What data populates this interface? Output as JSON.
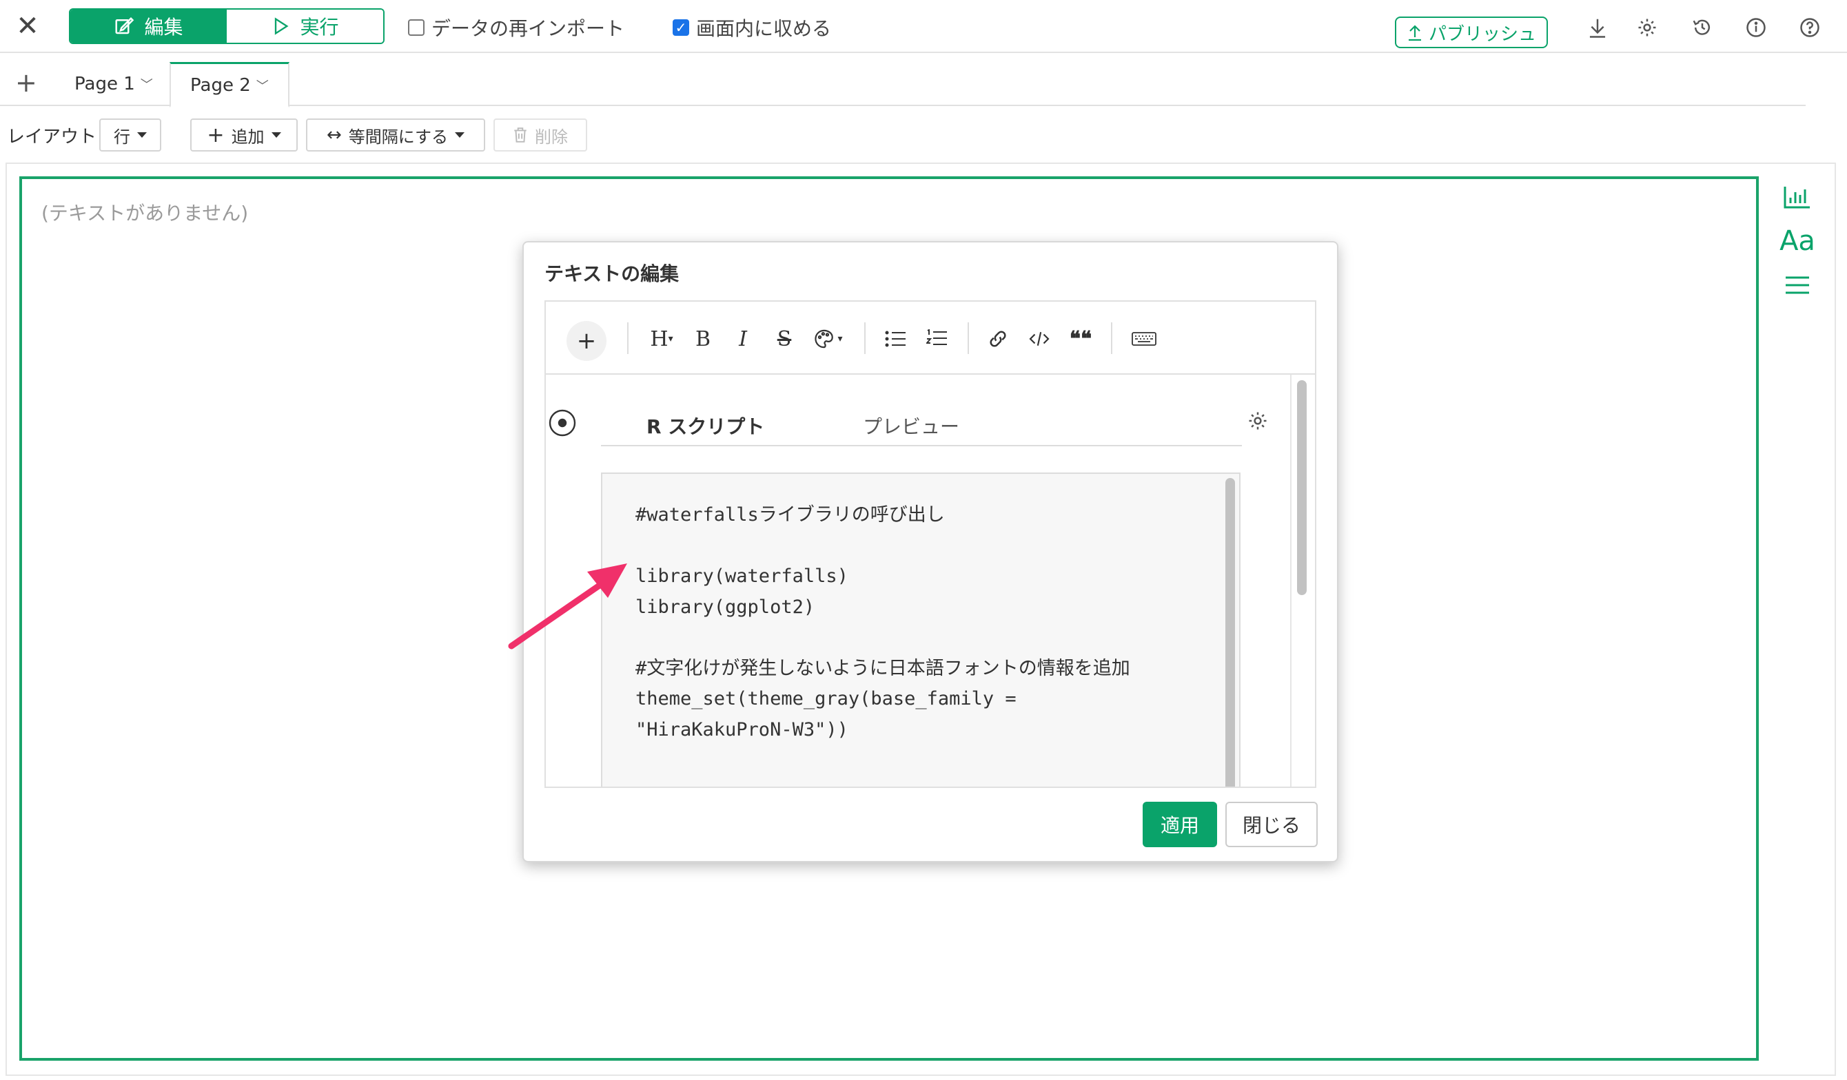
{
  "toolbar": {
    "edit_label": "編集",
    "run_label": "実行",
    "reimport_label": "データの再インポート",
    "reimport_checked": false,
    "fit_label": "画面内に収める",
    "fit_checked": true,
    "publish_label": "パブリッシュ"
  },
  "tabs": {
    "items": [
      {
        "label": "Page 1",
        "active": false
      },
      {
        "label": "Page 2",
        "active": true
      }
    ]
  },
  "layoutbar": {
    "layout_label": "レイアウト",
    "row_label": "行",
    "add_label": "追加",
    "spacing_label": "等間隔にする",
    "delete_label": "削除"
  },
  "canvas": {
    "placeholder": "(テキストがありません)"
  },
  "dialog": {
    "title": "テキストの編集",
    "tab_script": "R スクリプト",
    "tab_preview": "プレビュー",
    "code_lines": [
      "#waterfallsライブラリの呼び出し",
      "",
      "library(waterfalls)",
      "library(ggplot2)",
      "",
      "#文字化けが発生しないように日本語フォントの情報を追加",
      "theme_set(theme_gray(base_family =",
      "\"HiraKakuProN-W3\"))"
    ],
    "apply_label": "適用",
    "close_label": "閉じる"
  },
  "colors": {
    "accent": "#0aa36a",
    "annotation_arrow": "#f0306a"
  }
}
